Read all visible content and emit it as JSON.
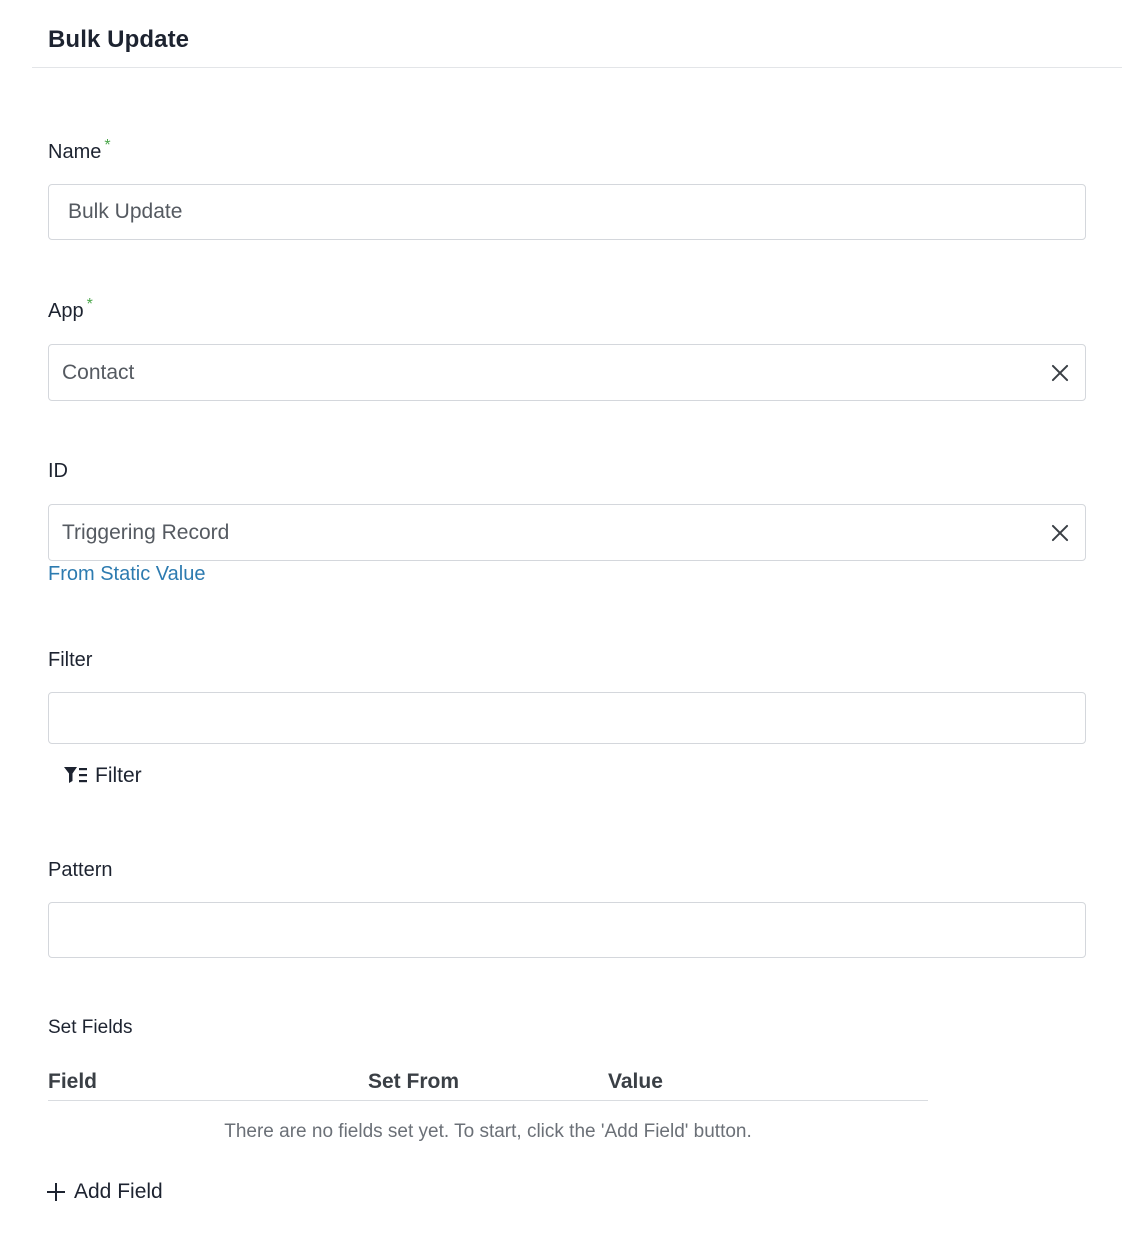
{
  "header": {
    "title": "Bulk Update"
  },
  "form": {
    "name": {
      "label": "Name",
      "required_mark": "*",
      "value": "Bulk Update"
    },
    "app": {
      "label": "App",
      "required_mark": "*",
      "value": "Contact"
    },
    "id": {
      "label": "ID",
      "value": "Triggering Record",
      "link": "From Static Value"
    },
    "filter": {
      "label": "Filter",
      "value": "",
      "button_label": "Filter"
    },
    "pattern": {
      "label": "Pattern",
      "value": ""
    }
  },
  "set_fields": {
    "label": "Set Fields",
    "columns": [
      "Field",
      "Set From",
      "Value"
    ],
    "empty_message": "There are no fields set yet. To start, click the 'Add Field' button.",
    "add_button_label": "Add Field"
  },
  "icons": {
    "clear": "close-icon",
    "filter": "filter-icon",
    "add": "plus-icon"
  },
  "colors": {
    "required": "#4aa64a",
    "link": "#2d7bb0"
  }
}
